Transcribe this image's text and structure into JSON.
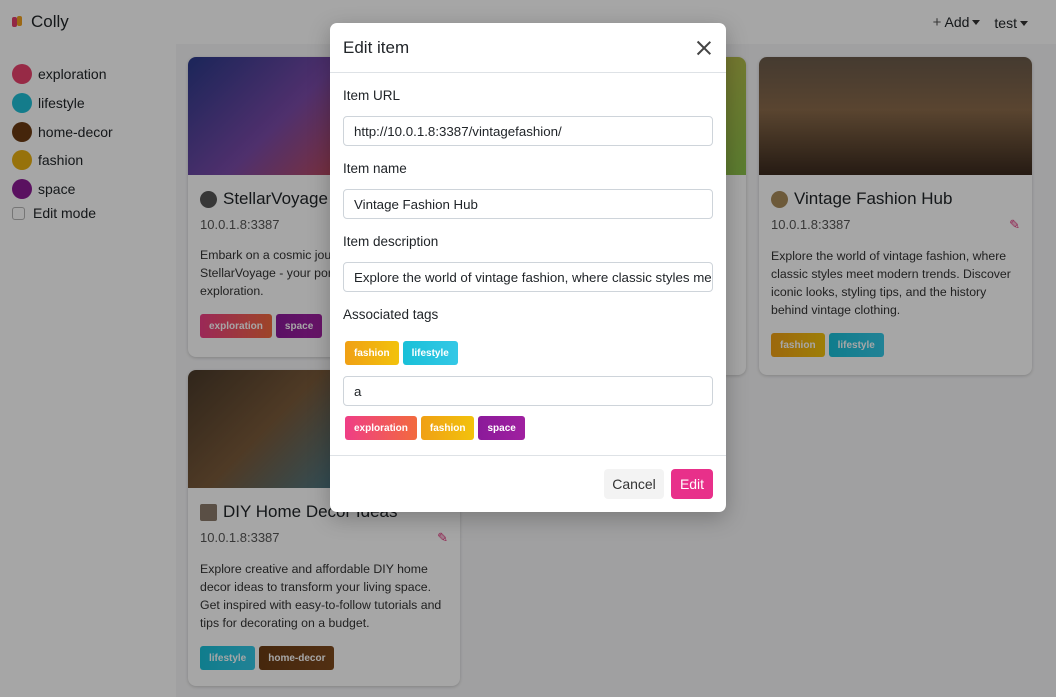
{
  "app": {
    "name": "Colly"
  },
  "header": {
    "add_label": "Add",
    "user_label": "test"
  },
  "sidebar": {
    "items": [
      {
        "label": "exploration",
        "color": "#e8416c"
      },
      {
        "label": "lifestyle",
        "color": "#1fbfd6"
      },
      {
        "label": "home-decor",
        "color": "#6b3a12"
      },
      {
        "label": "fashion",
        "color": "#e8b012"
      },
      {
        "label": "space",
        "color": "#8a1b94"
      }
    ],
    "edit_mode_label": "Edit mode"
  },
  "cards": [
    {
      "title": "StellarVoyage",
      "url": "10.0.1.8:3387",
      "desc": "Embark on a cosmic journey with StellarVoyage - your portal to space exploration.",
      "tags": [
        "exploration",
        "space"
      ]
    },
    {
      "title": "DIY Home Decor Ideas",
      "url": "10.0.1.8:3387",
      "desc": "Explore creative and affordable DIY home decor ideas to transform your living space. Get inspired with easy-to-follow tutorials and tips for decorating on a budget.",
      "tags": [
        "lifestyle",
        "home-decor"
      ]
    },
    {
      "title": "Vintage Fashion Hub",
      "url": "10.0.1.8:3387",
      "desc": "Explore the world of vintage fashion, where classic styles meet modern trends. Discover iconic looks, styling tips, and the history behind vintage clothing.",
      "tags": [
        "fashion",
        "lifestyle"
      ]
    }
  ],
  "modal": {
    "title": "Edit item",
    "url_label": "Item URL",
    "url_value": "http://10.0.1.8:3387/vintagefashion/",
    "name_label": "Item name",
    "name_value": "Vintage Fashion Hub",
    "desc_label": "Item description",
    "desc_value": "Explore the world of vintage fashion, where classic styles meet modern trends.",
    "tags_label": "Associated tags",
    "selected_tags": [
      "fashion",
      "lifestyle"
    ],
    "tag_input_value": "a",
    "suggested_tags": [
      "exploration",
      "fashion",
      "space"
    ],
    "cancel_label": "Cancel",
    "edit_label": "Edit"
  }
}
